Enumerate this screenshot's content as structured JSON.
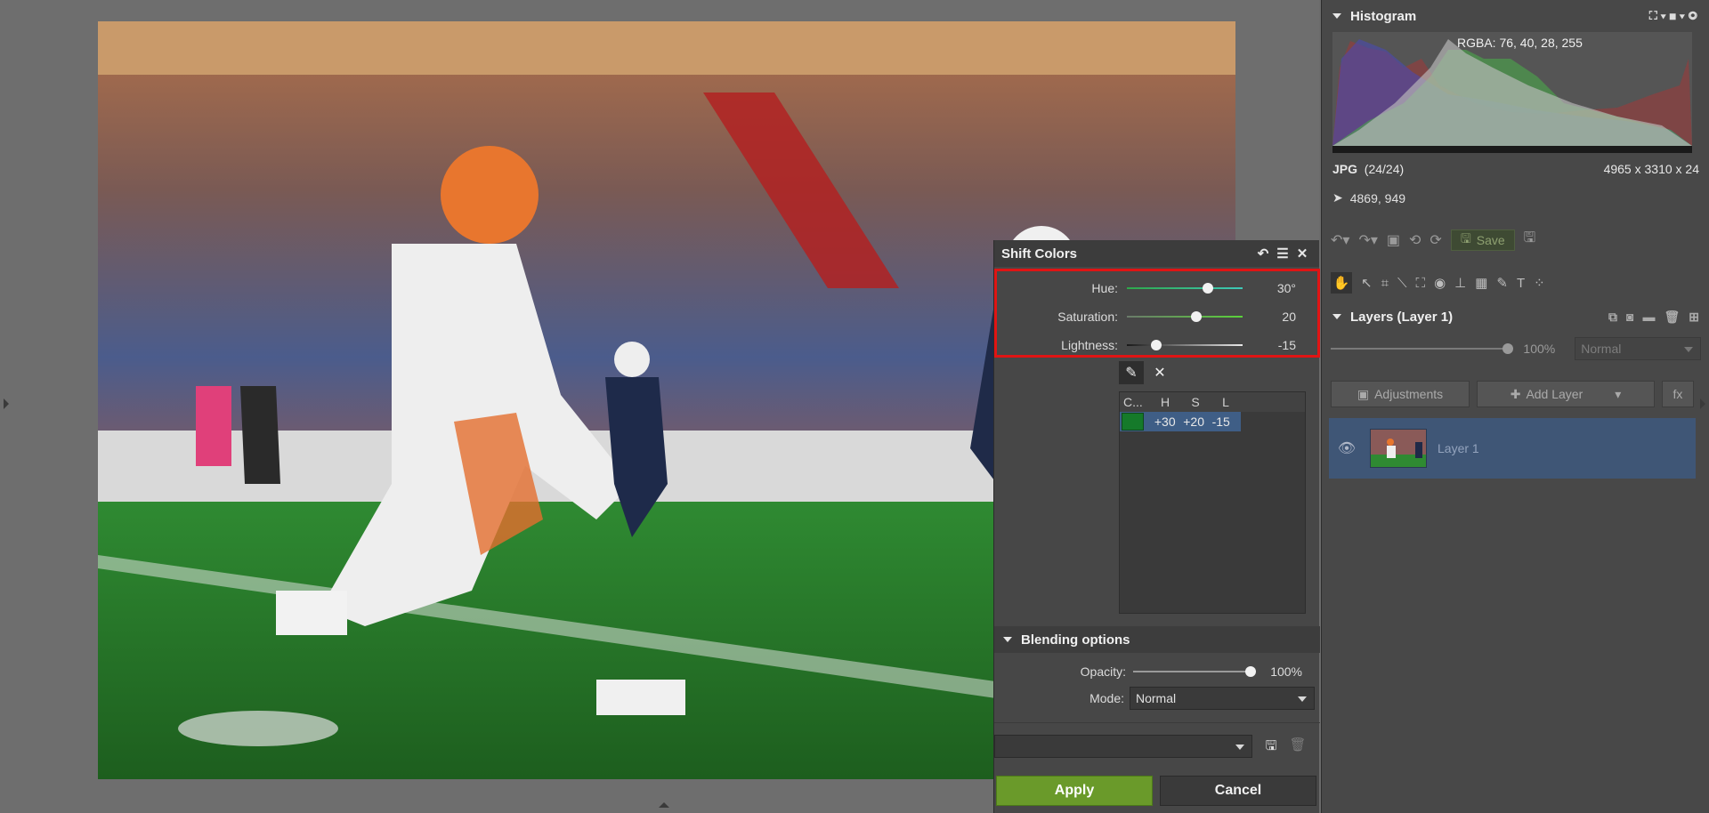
{
  "dialog": {
    "title": "Shift Colors",
    "params": [
      {
        "label": "Hue:",
        "value": "30°",
        "level": 0.7
      },
      {
        "label": "Saturation:",
        "value": "20",
        "level": 0.6
      },
      {
        "label": "Lightness:",
        "value": "-15",
        "level": 0.25
      }
    ],
    "table": {
      "headers": [
        "C...",
        "H",
        "S",
        "L"
      ],
      "row": {
        "h": "+30",
        "s": "+20",
        "l": "-15",
        "swatch_color": "#157a2a"
      }
    },
    "blending": {
      "title": "Blending options",
      "opacity_label": "Opacity:",
      "opacity_value": "100%",
      "opacity_level": 1.0,
      "mode_label": "Mode:",
      "mode_value": "Normal"
    },
    "apply_label": "Apply",
    "cancel_label": "Cancel"
  },
  "panel": {
    "histogram_title": "Histogram",
    "rgba": "RGBA:  76,  40,  28, 255",
    "file_type": "JPG",
    "file_index": "(24/24)",
    "dimensions": "4965 x 3310 x 24",
    "cursor": "4869, 949",
    "save_label": "Save",
    "layers_title": "Layers (Layer 1)",
    "layer_opacity": "100%",
    "layer_opacity_level": 1.0,
    "layer_blend_mode": "Normal",
    "adjustments_label": "Adjustments",
    "add_layer_label": "Add Layer",
    "fx_label": "fx",
    "layer_name": "Layer 1"
  },
  "colors": {
    "accent_red": "#e01414",
    "apply_green": "#6a9a2a",
    "selection_blue": "#3f5676"
  }
}
